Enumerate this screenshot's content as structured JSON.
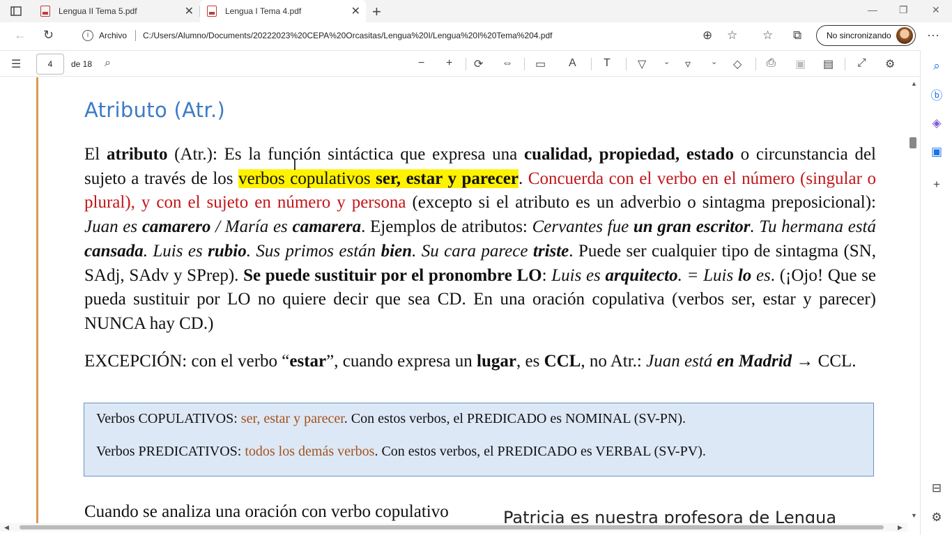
{
  "tabs": [
    {
      "label": "Lengua II Tema 5.pdf",
      "active": false
    },
    {
      "label": "Lengua I Tema 4.pdf",
      "active": true
    }
  ],
  "address": {
    "site_label": "Archivo",
    "url": "C:/Users/Alumno/Documents/20222023%20CEPA%20Orcasitas/Lengua%20I/Lengua%20I%20Tema%204.pdf"
  },
  "profile": {
    "sync_label": "No sincronizando"
  },
  "pdf_toolbar": {
    "page_number": "4",
    "page_total_label": "de 18"
  },
  "document": {
    "heading": "Atributo (Atr.)",
    "para1": {
      "s1": "El ",
      "s2": "atributo",
      "s3": " (Atr.): Es la función sintáctica que expresa una ",
      "s4": "cualidad, propiedad, estado",
      "s5": " o circunstancia del sujeto a través de los ",
      "s6_hl": "verbos copulativos ",
      "s7_hl_bold": "ser, estar y parecer",
      "s8": ". ",
      "s9_red": "Concuerda con el verbo en el número (singular o plural), y con el sujeto en número y persona",
      "s10": " (excepto si el atributo es un adverbio o sintagma preposicional): ",
      "s11_i": "Juan es ",
      "s12_bi": "camarero",
      "s13_i": " / María es ",
      "s14_bi": "camarera",
      "s15": ". Ejemplos de atributos: ",
      "s16_i": "Cervantes fue ",
      "s17_bi": "un gran escritor",
      "s18_i": ". Tu hermana está ",
      "s19_bi": "cansada",
      "s20_i": ". Luis es ",
      "s21_bi": "rubio",
      "s22_i": ". Sus primos están ",
      "s23_bi": "bien",
      "s24_i": ". Su cara parece ",
      "s25_bi": "triste",
      "s26": ". Puede ser cualquier tipo de sintagma (SN, SAdj, SAdv y SPrep). ",
      "s27_b": "Se puede sustituir por el pronombre LO",
      "s28": ": ",
      "s29_i": "Luis es ",
      "s30_bi": "arquitecto",
      "s31_i": ". = Luis ",
      "s32_bi": "lo",
      "s33_i": " es",
      "s34": ". (¡Ojo! Que se pueda sustituir por LO no quiere decir que sea CD. En una oración copulativa (verbos ser, estar y parecer) NUNCA hay CD.)"
    },
    "para2": {
      "s1": "EXCEPCIÓN: con el verbo “",
      "s2_b": "estar",
      "s3": "”, cuando expresa un ",
      "s4_b": "lugar",
      "s5": ", es ",
      "s6_b": "CCL",
      "s7": ", no Atr.: ",
      "s8_i": "Juan está ",
      "s9_bi": "en Madrid",
      "s10": " → CCL."
    },
    "box": {
      "row1_a": "Verbos COPULATIVOS: ",
      "row1_b": "ser, estar y parecer",
      "row1_c": ". Con estos verbos, el PREDICADO es NOMINAL (SV-PN).",
      "row2_a": "Verbos PREDICATIVOS: ",
      "row2_b": "todos los demás verbos",
      "row2_c": ". Con estos verbos, el PREDICADO es VERBAL (SV-PV)."
    },
    "para3": "Cuando se analiza una oración con verbo copulativo",
    "handwritten_note": "Patricia es nuestra profesora de Lengua"
  },
  "colors": {
    "heading": "#3c7bc4",
    "red_text": "#c0161a",
    "highlight": "#fff200",
    "box_bg": "#dce8f5",
    "box_accent": "#a3521e",
    "margin_line": "#d99a4e"
  }
}
